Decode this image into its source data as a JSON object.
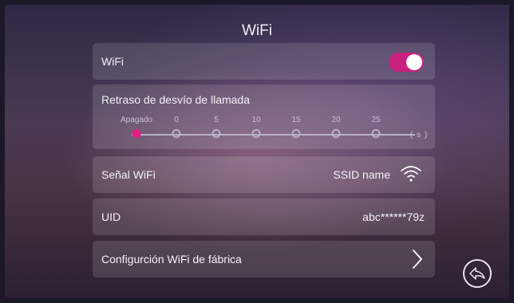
{
  "title": "WiFi",
  "wifi": {
    "label": "WiFi",
    "enabled": true,
    "accent": "#c8207f"
  },
  "delay": {
    "label": "Retraso de desvío de llamada",
    "options": [
      "Apagado",
      "0",
      "5",
      "10",
      "15",
      "20",
      "25"
    ],
    "selected_index": 0,
    "unit": "( s )"
  },
  "signal": {
    "label": "Señal WiFi",
    "ssid": "SSID name",
    "icon": "wifi-icon"
  },
  "uid": {
    "label": "UID",
    "value": "abc******79z"
  },
  "factory": {
    "label": "Configurción WiFi de fábrica",
    "icon": "chevron-right-icon"
  },
  "back": {
    "icon": "back-icon"
  }
}
